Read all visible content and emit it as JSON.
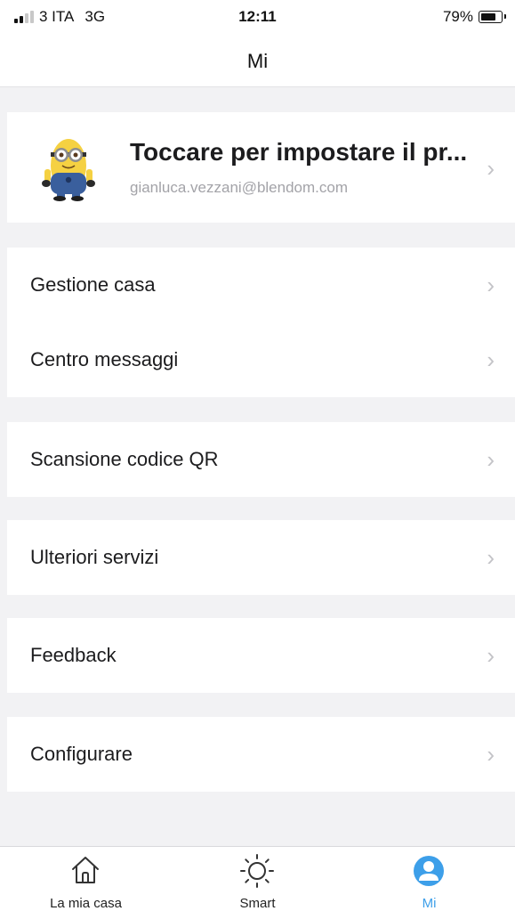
{
  "status_bar": {
    "carrier": "3 ITA",
    "network": "3G",
    "time": "12:11",
    "battery": "79%",
    "battery_level": 0.79,
    "signal_bars_active": 2
  },
  "header": {
    "title": "Mi"
  },
  "profile": {
    "name": "Toccare per impostare il pr...",
    "email": "gianluca.vezzani@blendom.com",
    "avatar_icon": "minion-avatar"
  },
  "menu": {
    "items": [
      {
        "label": "Gestione casa"
      },
      {
        "label": "Centro messaggi"
      },
      {
        "label": "Scansione codice QR"
      },
      {
        "label": "Ulteriori servizi"
      },
      {
        "label": "Feedback"
      },
      {
        "label": "Configurare"
      }
    ],
    "chevron": "›"
  },
  "tab_bar": {
    "tabs": [
      {
        "label": "La mia casa",
        "icon": "home-icon"
      },
      {
        "label": "Smart",
        "icon": "sun-icon"
      },
      {
        "label": "Mi",
        "icon": "profile-icon"
      }
    ],
    "active_index": 2
  },
  "colors": {
    "accent": "#3d9fe9",
    "background": "#f2f2f4",
    "surface": "#ffffff",
    "secondary_text": "#a3a3a8",
    "chevron": "#c3c3c7"
  }
}
